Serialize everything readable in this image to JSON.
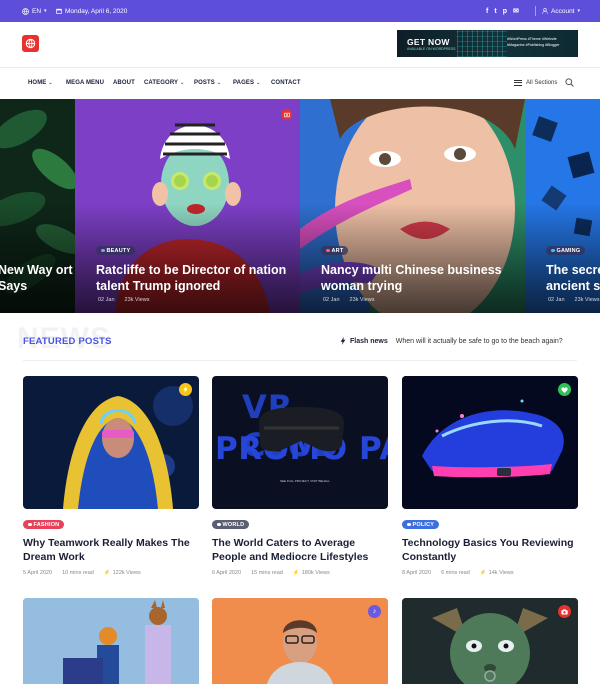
{
  "topbar": {
    "language": "EN",
    "date": "Monday, April 6, 2020",
    "social": [
      "f",
      "t",
      "p",
      "m"
    ],
    "account": "Account"
  },
  "header": {
    "banner_title": "GET NOW",
    "banner_subtitle": "AVAILABLE ON WORDPRESS",
    "banner_tags": "#WordPress #Theme #Website #Magazine #Publishing #Blogger"
  },
  "nav": {
    "items": [
      "HOME",
      "MEGA MENU",
      "ABOUT",
      "CATEGORY",
      "POSTS",
      "PAGES",
      "CONTACT"
    ],
    "all_sections": "All Sections"
  },
  "hero": {
    "slides": [
      {
        "category": "",
        "title": "New Way ort Says",
        "date": "",
        "views": ""
      },
      {
        "category": "BEAUTY",
        "title": "Ratcliffe to be Director of nation talent Trump ignored",
        "date": "02 Jan",
        "views": "23k Views"
      },
      {
        "category": "ART",
        "title": "Nancy multi Chinese business woman trying",
        "date": "02 Jan",
        "views": "23k Views"
      },
      {
        "category": "GAMING",
        "title": "The secre ancient s",
        "date": "02 Jan",
        "views": "23k Views"
      }
    ]
  },
  "featured": {
    "bg_word": "NEWS",
    "title": "FEATURED POSTS",
    "flash_label": "Flash news",
    "flash_text": "When will it actually be safe to go to the beach again?"
  },
  "cards": [
    {
      "category": "FASHION",
      "title": "Why Teamwork Really Makes The Dream Work",
      "date": "5 April 2020",
      "read": "10 mins read",
      "views": "122k Views"
    },
    {
      "category": "WORLD",
      "title": "The World Caters to Average People and Mediocre Lifestyles",
      "date": "6 April 2020",
      "read": "15 mins read",
      "views": "180k Views",
      "image_text_1": "VR CLUB",
      "image_text_2": "PROMO PAGE",
      "image_caption": "SEE FULL PROJECT, VISIT BEHALL"
    },
    {
      "category": "POLICY",
      "title": "Technology Basics You Reviewing Constantly",
      "date": "8 April 2020",
      "read": "6 mins read",
      "views": "14k Views"
    }
  ],
  "colors": {
    "topbar": "#5d4fd9",
    "accent": "#4b53e0",
    "fashion": "#e8415a",
    "world": "#5a5f73",
    "policy": "#3d6fe0"
  }
}
